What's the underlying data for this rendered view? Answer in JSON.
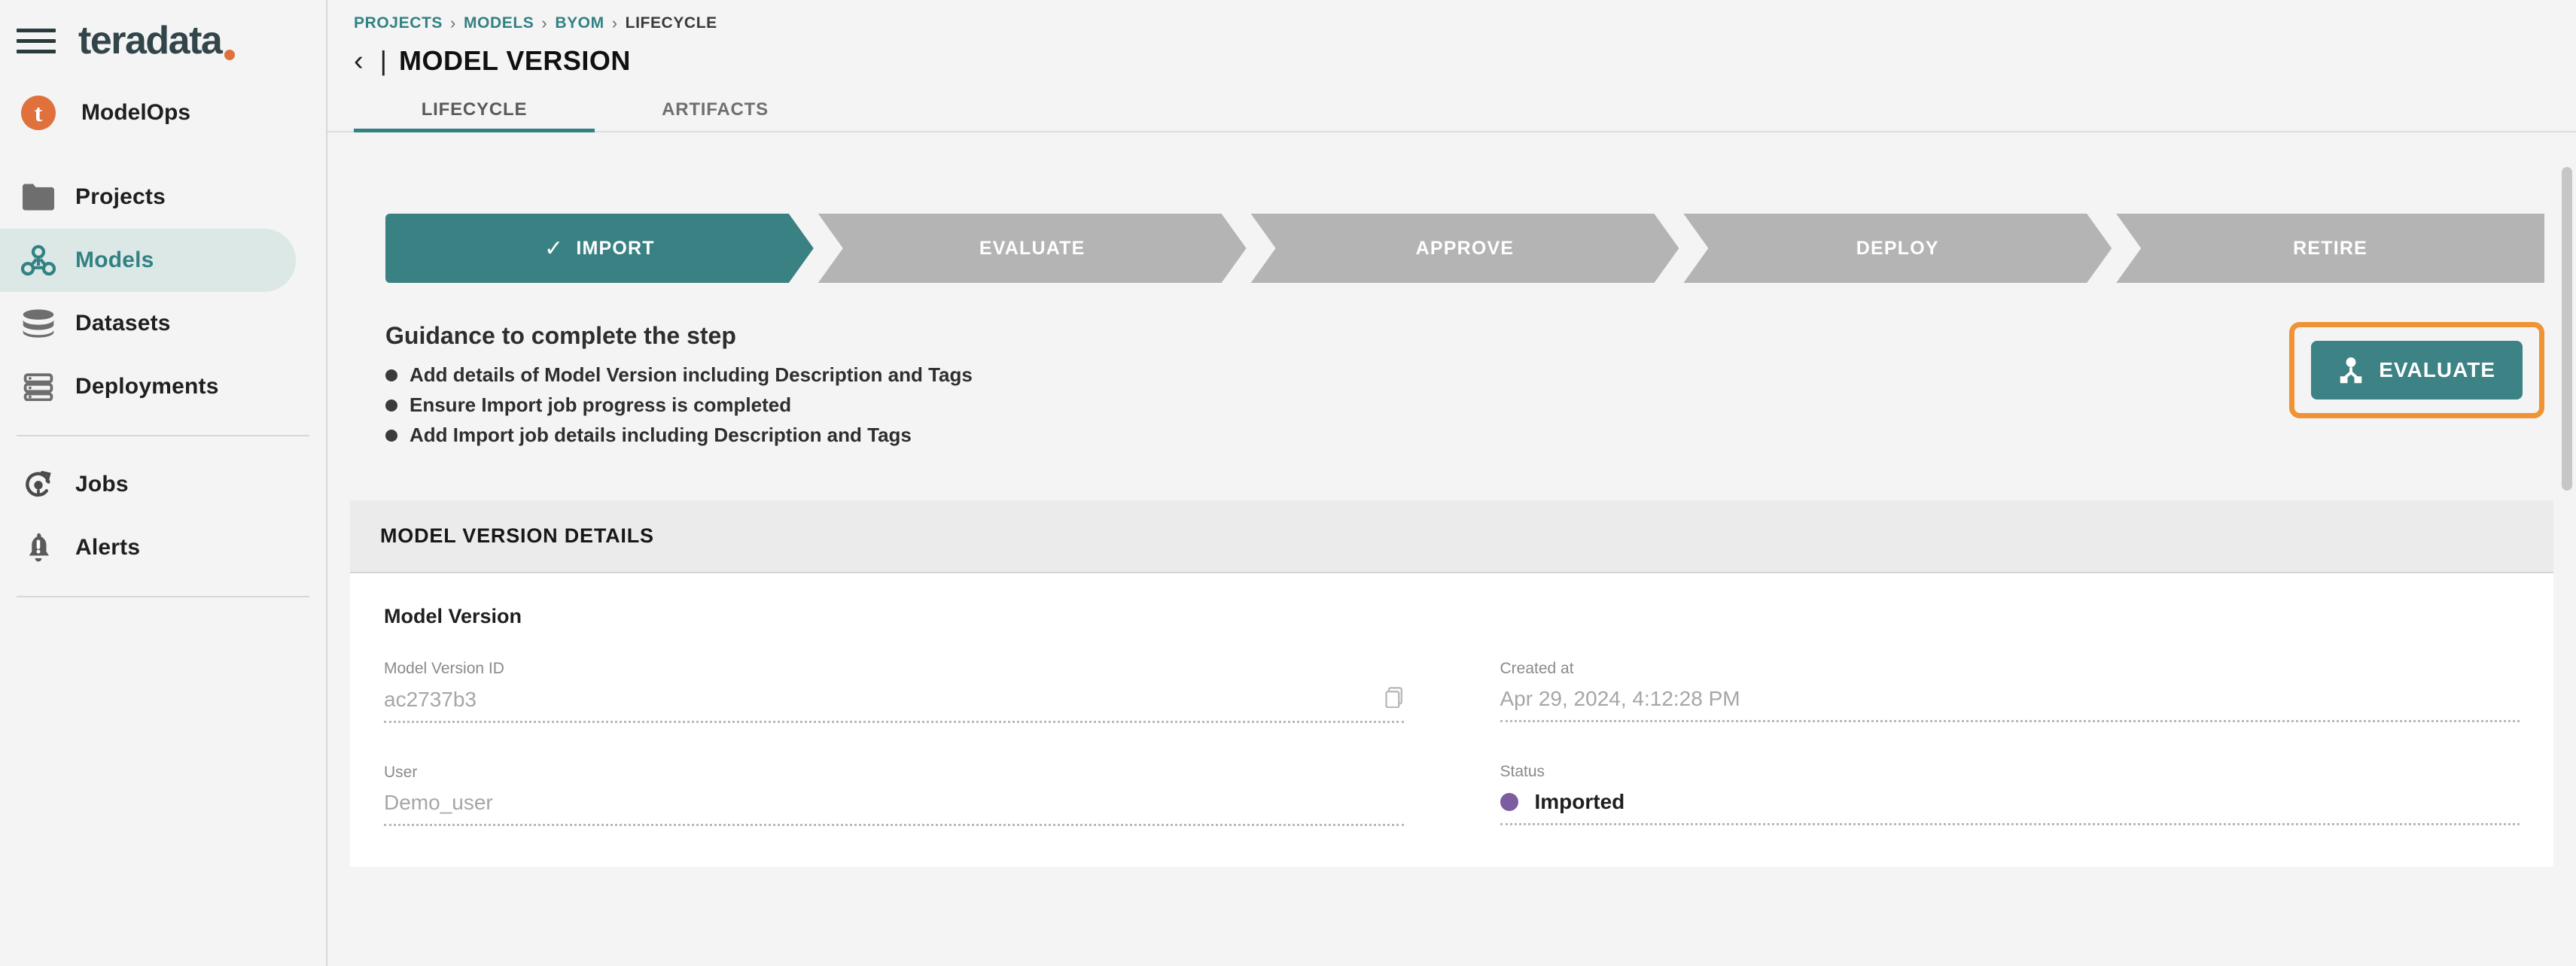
{
  "sidebar": {
    "brand": {
      "badge_letter": "t",
      "label": "ModelOps"
    },
    "logo": {
      "text": "teradata"
    },
    "items": [
      {
        "label": "Projects",
        "icon": "folder-icon",
        "active": false
      },
      {
        "label": "Models",
        "icon": "model-graph-icon",
        "active": true
      },
      {
        "label": "Datasets",
        "icon": "database-icon",
        "active": false
      },
      {
        "label": "Deployments",
        "icon": "server-icon",
        "active": false
      },
      {
        "label": "Jobs",
        "icon": "refresh-job-icon",
        "active": false
      },
      {
        "label": "Alerts",
        "icon": "bell-alert-icon",
        "active": false
      }
    ]
  },
  "header": {
    "breadcrumb": [
      "PROJECTS",
      "MODELS",
      "BYOM",
      "LIFECYCLE"
    ],
    "breadcrumb_separator": "›",
    "back_icon": "chevron-left-icon",
    "divider": "|",
    "title": "MODEL VERSION",
    "tabs": [
      {
        "label": "LIFECYCLE",
        "active": true
      },
      {
        "label": "ARTIFACTS",
        "active": false
      }
    ]
  },
  "stepper": {
    "steps": [
      {
        "label": "IMPORT",
        "state": "done",
        "check": "✓"
      },
      {
        "label": "EVALUATE",
        "state": "pending"
      },
      {
        "label": "APPROVE",
        "state": "pending"
      },
      {
        "label": "DEPLOY",
        "state": "pending"
      },
      {
        "label": "RETIRE",
        "state": "pending"
      }
    ]
  },
  "guidance": {
    "heading": "Guidance to complete the step",
    "bullets": [
      "Add details of Model Version including Description and Tags",
      "Ensure Import job progress is completed",
      "Add Import job details including Description and Tags"
    ]
  },
  "evaluate_action": {
    "label": "EVALUATE",
    "icon": "evaluate-node-icon",
    "highlighted": true,
    "highlight_color": "#ef9334",
    "button_color": "#3d8285"
  },
  "details_panel": {
    "header": "MODEL VERSION DETAILS",
    "section_title": "Model Version",
    "fields": [
      {
        "label": "Model Version ID",
        "value": "ac2737b3",
        "copyable": true,
        "copy_icon": "copy-icon"
      },
      {
        "label": "Created at",
        "value": "Apr 29, 2024, 4:12:28 PM",
        "copyable": false
      },
      {
        "label": "User",
        "value": "Demo_user",
        "copyable": false
      },
      {
        "label": "Status",
        "value": "Imported",
        "copyable": false,
        "dot_color": "#7c5ea0"
      }
    ]
  },
  "theme": {
    "accent_teal": "#338183",
    "brand_orange": "#e1713c",
    "highlight_orange": "#ef9334",
    "status_purple": "#7c5ea0",
    "step_pending_gray": "#b4b4b4"
  }
}
